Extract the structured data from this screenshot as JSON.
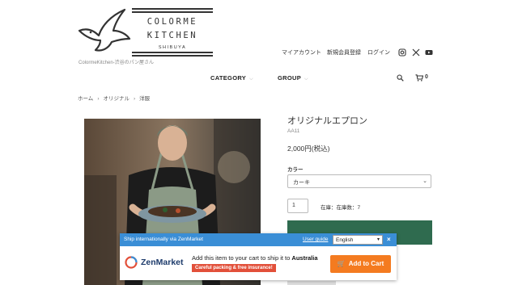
{
  "logo": {
    "line1": "COLORME",
    "line2": "KITCHEN",
    "location": "SHIBUYA",
    "tagline": "ColormeKitchen-渋谷のパン屋さん"
  },
  "header": {
    "links": [
      "マイアカウント",
      "新規会員登録",
      "ログイン"
    ],
    "icons": [
      "instagram-icon",
      "x-icon",
      "youtube-icon"
    ],
    "search_icon": "search-icon",
    "cart_count": "0"
  },
  "nav": {
    "items": [
      "CATEGORY",
      "GROUP"
    ]
  },
  "breadcrumb": [
    "ホーム",
    "オリジナル",
    "洋服"
  ],
  "product": {
    "title": "オリジナルエプロン",
    "sku": "AA11",
    "price": "2,000円(税込)",
    "option_label": "カラー",
    "option_value": "カーキ",
    "quantity": "1",
    "stock": "在庫：在庫数：7",
    "cart_button_color": "#2f6b4f"
  },
  "zenmarket": {
    "header_text": "Ship internationally via ZenMarket",
    "guide_link": "User guide",
    "language": "English",
    "close": "×",
    "logo_text": "ZenMarket",
    "message_prefix": "Add this item to your cart to ship it to",
    "country": "Australia",
    "badge": "Careful packing & free insurance!",
    "cart_button": "Add to Cart",
    "accent": "#3a8ed6",
    "button_color": "#f47b20"
  }
}
